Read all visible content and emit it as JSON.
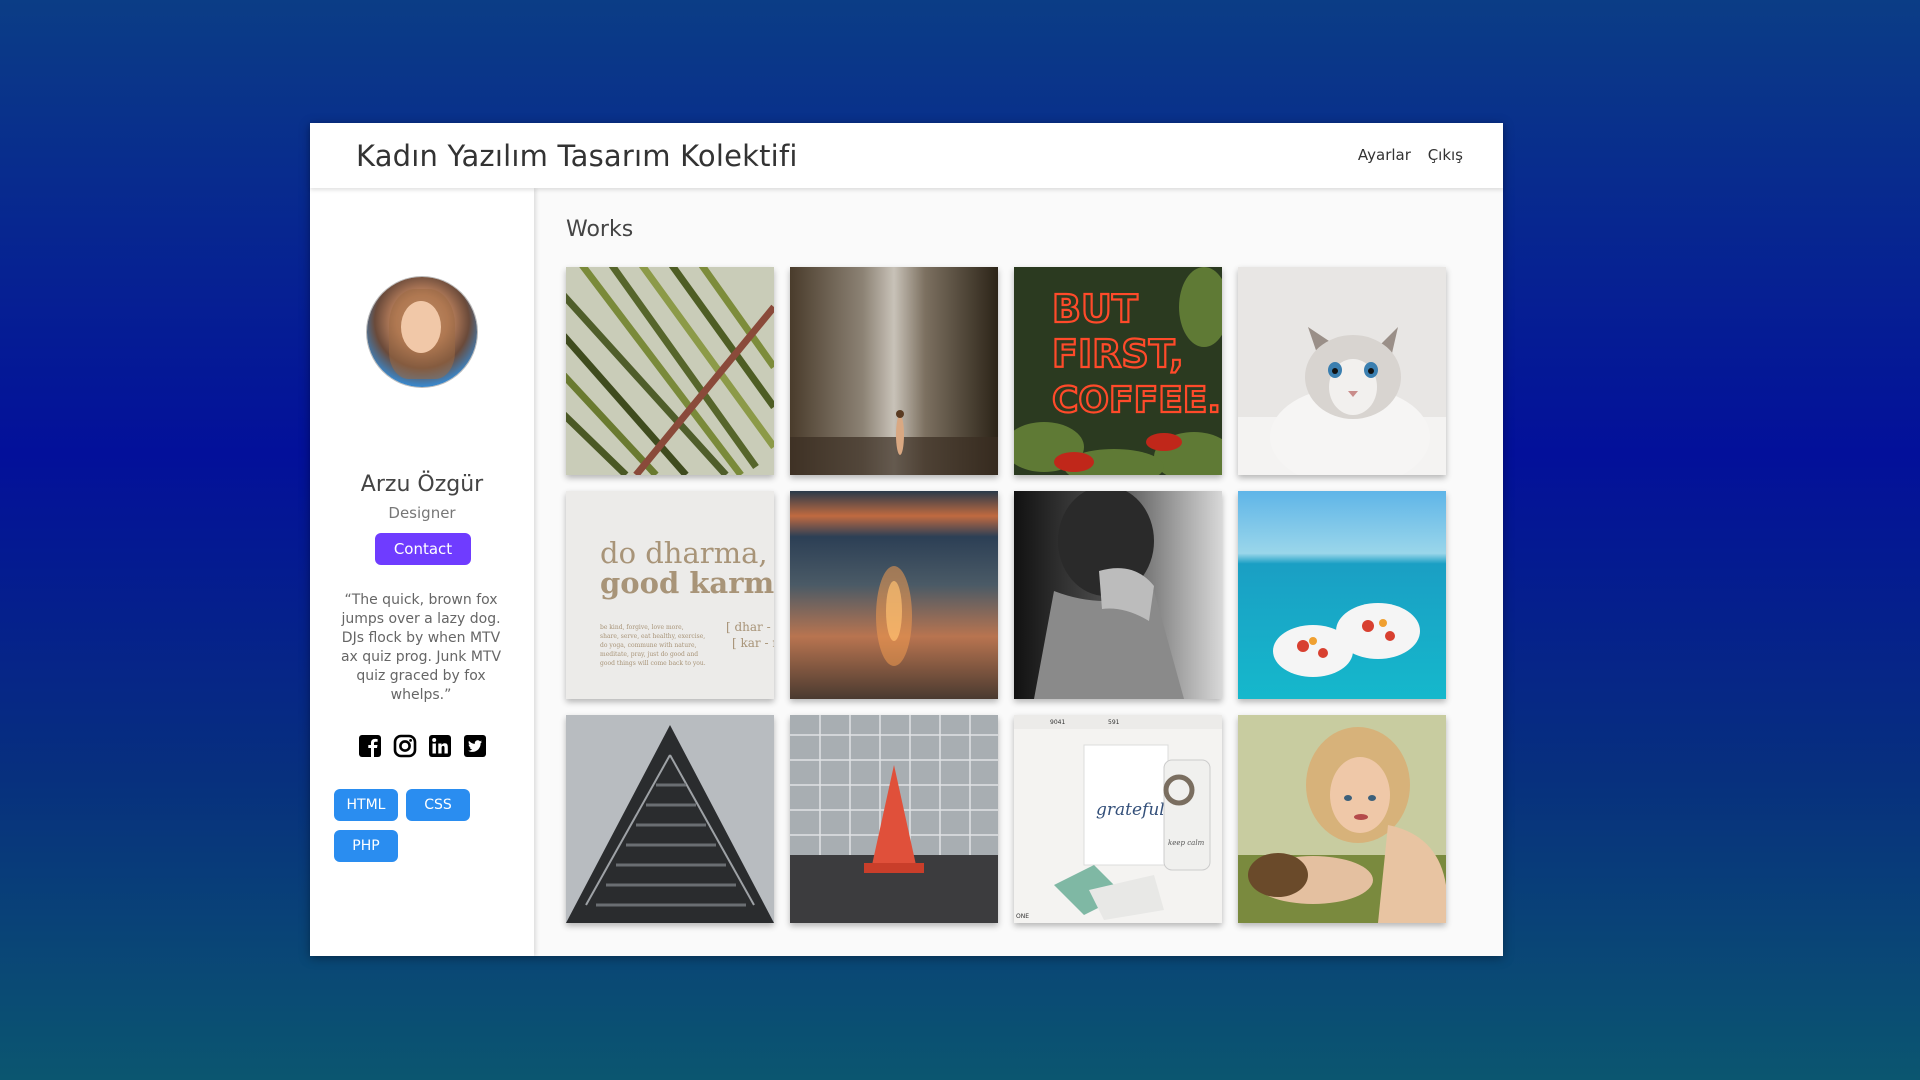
{
  "header": {
    "title": "Kadın Yazılım Tasarım Kolektifi",
    "nav": [
      "Ayarlar",
      "Çıkış"
    ]
  },
  "profile": {
    "name": "Arzu Özgür",
    "role": "Designer",
    "contact_label": "Contact",
    "quote": "“The quick, brown fox jumps over a lazy dog. DJs flock by when MTV ax quiz prog. Junk MTV quiz graced by fox whelps.”",
    "socials": [
      "facebook-icon",
      "instagram-icon",
      "linkedin-icon",
      "twitter-icon"
    ],
    "tags": [
      "HTML",
      "CSS",
      "PHP"
    ]
  },
  "works": {
    "title": "Works",
    "items": [
      {
        "name": "palm-leaf",
        "text": []
      },
      {
        "name": "waterfall",
        "text": []
      },
      {
        "name": "neon-sign",
        "text": [
          "BUT",
          "FIRST,",
          "COFFEE."
        ]
      },
      {
        "name": "cat",
        "text": []
      },
      {
        "name": "typography-print",
        "text": [
          "do dharma,",
          "good karma",
          "[ dhar - m",
          "[ kar - m",
          "be kind, forgive, love more,",
          "share, serve, eat healthy, exercise,",
          "do yoga, commune with nature,",
          "meditate, pray, just do good and",
          "good things will come back to you."
        ]
      },
      {
        "name": "beach-sunset",
        "text": []
      },
      {
        "name": "neck-bw",
        "text": []
      },
      {
        "name": "ocean-breakfast",
        "text": []
      },
      {
        "name": "building",
        "text": []
      },
      {
        "name": "traffic-cone",
        "text": []
      },
      {
        "name": "grateful-desk",
        "text": [
          "grateful",
          "9041",
          "591",
          "ONE",
          "keep calm"
        ]
      },
      {
        "name": "two-women",
        "text": []
      }
    ]
  },
  "colors": {
    "accent": "#6f3cff",
    "tag": "#2a8df0"
  }
}
